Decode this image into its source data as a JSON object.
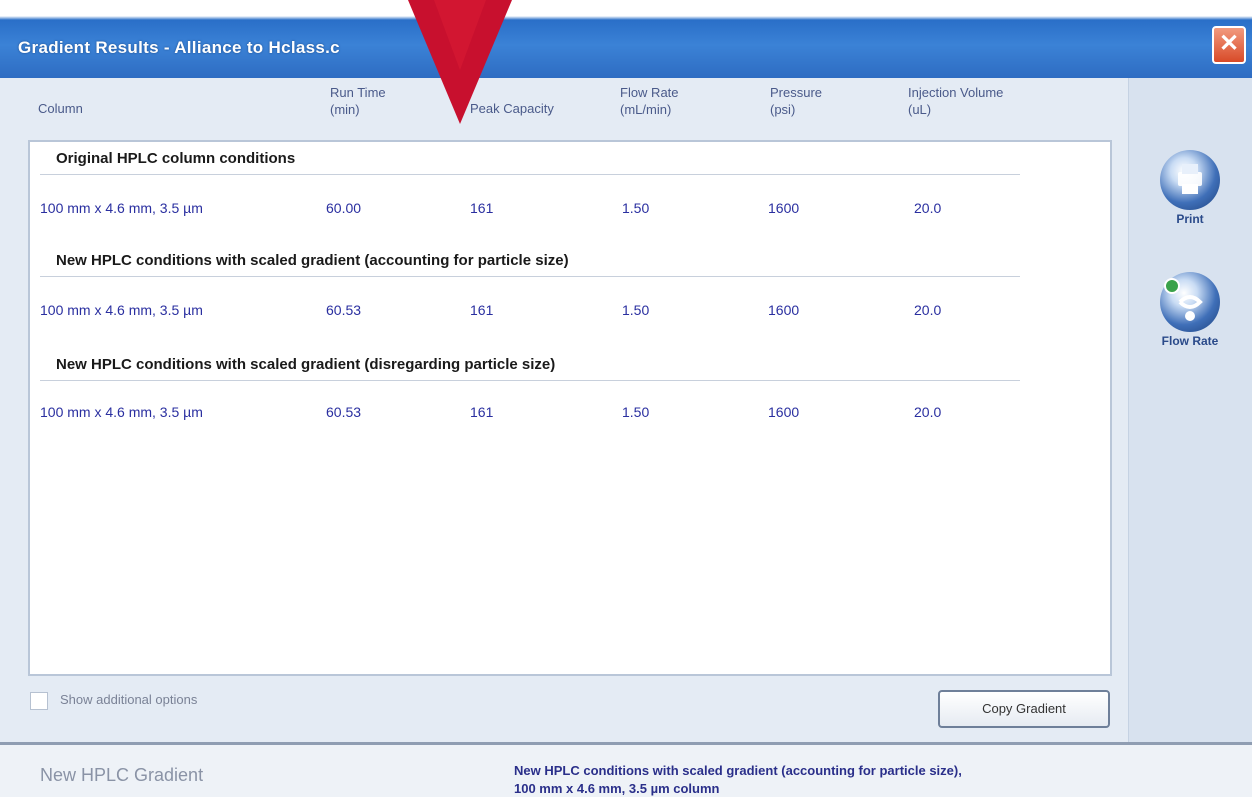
{
  "window": {
    "title": "Gradient Results - Alliance to Hclass.c",
    "close_label": "✕"
  },
  "columns": [
    {
      "line1": "Column",
      "line2": ""
    },
    {
      "line1": "Run Time",
      "line2": "(min)"
    },
    {
      "line1": "Peak Capacity",
      "line2": ""
    },
    {
      "line1": "Flow Rate",
      "line2": "(mL/min)"
    },
    {
      "line1": "Pressure",
      "line2": "(psi)"
    },
    {
      "line1": "Injection Volume",
      "line2": "(uL)"
    }
  ],
  "sections": [
    {
      "title": "Original HPLC column conditions",
      "row": {
        "column": "100 mm x 4.6 mm, 3.5 µm",
        "run_time": "60.00",
        "peak_capacity": "161",
        "flow_rate": "1.50",
        "pressure": "1600",
        "injection_volume": "20.0"
      }
    },
    {
      "title": "New HPLC conditions with scaled gradient (accounting for particle size)",
      "row": {
        "column": "100 mm x 4.6 mm, 3.5 µm",
        "run_time": "60.53",
        "peak_capacity": "161",
        "flow_rate": "1.50",
        "pressure": "1600",
        "injection_volume": "20.0"
      }
    },
    {
      "title": "New HPLC conditions with scaled gradient (disregarding particle size)",
      "row": {
        "column": "100 mm x 4.6 mm, 3.5 µm",
        "run_time": "60.53",
        "peak_capacity": "161",
        "flow_rate": "1.50",
        "pressure": "1600",
        "injection_volume": "20.0"
      }
    }
  ],
  "side_buttons": [
    {
      "label": "Print",
      "icon": "print-icon"
    },
    {
      "label": "Flow Rate",
      "icon": "flow-rate-icon"
    }
  ],
  "options": {
    "show_additional_label": "Show additional options",
    "checked": false
  },
  "copy_button": {
    "label": "Copy Gradient"
  },
  "status": {
    "left": "New HPLC Gradient",
    "right_line1": "New HPLC conditions with scaled gradient (accounting for particle size),",
    "right_line2": "100 mm x 4.6 mm, 3.5 µm column"
  },
  "colors": {
    "titlebar": "#2e6cc2",
    "value_text": "#2a2fa0",
    "arrow": "#c8102e"
  }
}
